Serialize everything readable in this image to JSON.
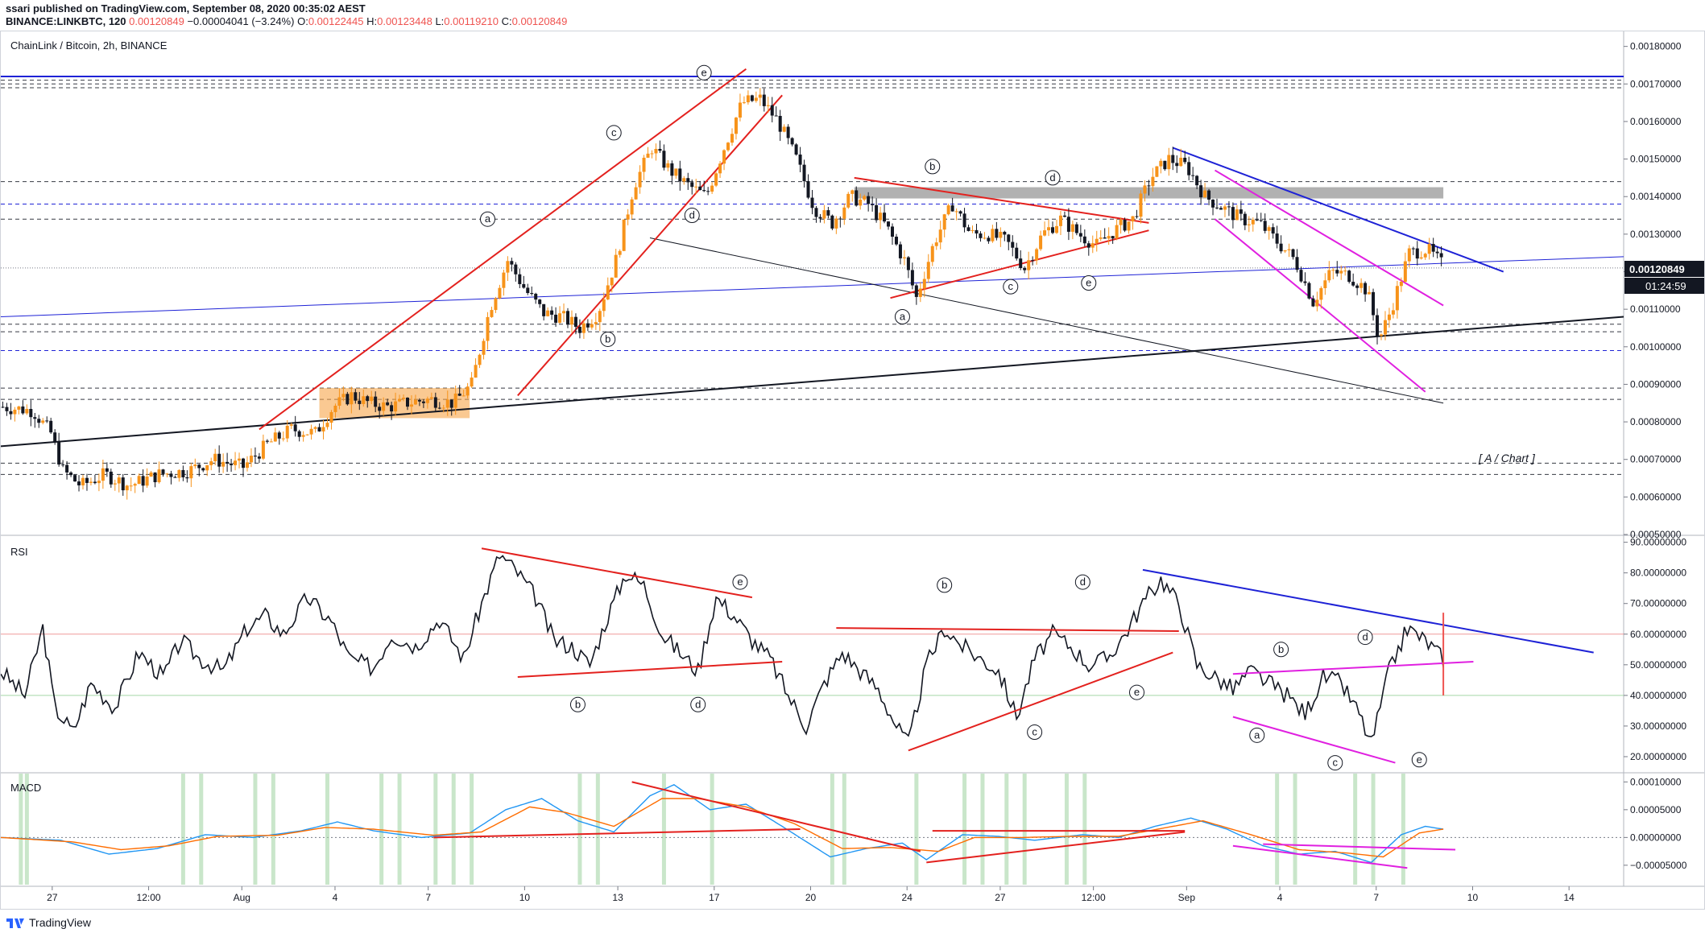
{
  "header": {
    "publisher_line": "ssari published on TradingView.com, September 08, 2020 00:35:02 AEST",
    "symbol": "BINANCE:LINKBTC, 120",
    "last": "0.00120849",
    "change": "−0.00004041 (−3.24%)",
    "open_label": "O:",
    "open": "0.00122445",
    "high_label": "H:",
    "high": "0.00123448",
    "low_label": "L:",
    "low": "0.00119210",
    "close_label": "C:",
    "close": "0.00120849"
  },
  "panes": {
    "main_title": "ChainLink / Bitcoin, 2h, BINANCE",
    "rsi_title": "RSI",
    "macd_title": "MACD",
    "annotation": "[ A / Chart ]"
  },
  "price_badge": {
    "price": "0.00120849",
    "countdown": "01:24:59"
  },
  "footer": {
    "brand": "TradingView"
  },
  "colors": {
    "up": "#f7931a",
    "down": "#131722",
    "red_line": "#e3211e",
    "blue_line": "#1e22d6",
    "magenta_line": "#e020e0"
  },
  "chart_data": [
    {
      "type": "candlestick",
      "title": "ChainLink / Bitcoin, 2h, BINANCE",
      "y_ticks": [
        "0.00180000",
        "0.00170000",
        "0.00160000",
        "0.00150000",
        "0.00140000",
        "0.00130000",
        "0.00120000",
        "0.00110000",
        "0.00100000",
        "0.00090000",
        "0.00080000",
        "0.00070000",
        "0.00060000",
        "0.00050000"
      ],
      "ylim": [
        0.0005,
        0.00184
      ],
      "x_ticks": [
        "27",
        "12:00",
        "Aug",
        "4",
        "7",
        "10",
        "13",
        "17",
        "20",
        "24",
        "27",
        "12:00",
        "Sep",
        "4",
        "7",
        "10",
        "14"
      ],
      "close_path": [
        {
          "x": 0,
          "y": 0.00084
        },
        {
          "x": 5,
          "y": 0.00083
        },
        {
          "x": 8,
          "y": 0.00077
        },
        {
          "x": 10,
          "y": 0.00067
        },
        {
          "x": 13,
          "y": 0.00063
        },
        {
          "x": 17,
          "y": 0.00066
        },
        {
          "x": 21,
          "y": 0.00063
        },
        {
          "x": 26,
          "y": 0.00066
        },
        {
          "x": 31,
          "y": 0.00067
        },
        {
          "x": 35,
          "y": 0.0007
        },
        {
          "x": 40,
          "y": 0.00068
        },
        {
          "x": 44,
          "y": 0.00074
        },
        {
          "x": 48,
          "y": 0.00078
        },
        {
          "x": 52,
          "y": 0.00077
        },
        {
          "x": 55,
          "y": 0.00084
        },
        {
          "x": 58,
          "y": 0.00087
        },
        {
          "x": 61,
          "y": 0.00085
        },
        {
          "x": 64,
          "y": 0.00084
        },
        {
          "x": 67,
          "y": 0.00085
        },
        {
          "x": 71,
          "y": 0.00086
        },
        {
          "x": 75,
          "y": 0.00085
        },
        {
          "x": 78,
          "y": 0.0009
        },
        {
          "x": 81,
          "y": 0.0011
        },
        {
          "x": 84,
          "y": 0.00123
        },
        {
          "x": 87,
          "y": 0.00115
        },
        {
          "x": 90,
          "y": 0.00109
        },
        {
          "x": 93,
          "y": 0.00108
        },
        {
          "x": 96,
          "y": 0.00105
        },
        {
          "x": 99,
          "y": 0.00109
        },
        {
          "x": 102,
          "y": 0.00123
        },
        {
          "x": 105,
          "y": 0.00143
        },
        {
          "x": 108,
          "y": 0.00153
        },
        {
          "x": 111,
          "y": 0.00147
        },
        {
          "x": 114,
          "y": 0.00143
        },
        {
          "x": 117,
          "y": 0.0014
        },
        {
          "x": 120,
          "y": 0.00153
        },
        {
          "x": 123,
          "y": 0.00165
        },
        {
          "x": 126,
          "y": 0.00166
        },
        {
          "x": 129,
          "y": 0.0016
        },
        {
          "x": 132,
          "y": 0.0015
        },
        {
          "x": 135,
          "y": 0.00137
        },
        {
          "x": 138,
          "y": 0.00133
        },
        {
          "x": 141,
          "y": 0.0014
        },
        {
          "x": 144,
          "y": 0.00138
        },
        {
          "x": 147,
          "y": 0.00132
        },
        {
          "x": 150,
          "y": 0.00123
        },
        {
          "x": 152,
          "y": 0.00113
        },
        {
          "x": 155,
          "y": 0.00128
        },
        {
          "x": 158,
          "y": 0.00138
        },
        {
          "x": 161,
          "y": 0.0013
        },
        {
          "x": 164,
          "y": 0.0013
        },
        {
          "x": 167,
          "y": 0.00128
        },
        {
          "x": 170,
          "y": 0.00121
        },
        {
          "x": 173,
          "y": 0.0013
        },
        {
          "x": 176,
          "y": 0.00134
        },
        {
          "x": 179,
          "y": 0.0013
        },
        {
          "x": 182,
          "y": 0.00127
        },
        {
          "x": 185,
          "y": 0.00131
        },
        {
          "x": 188,
          "y": 0.00134
        },
        {
          "x": 191,
          "y": 0.00145
        },
        {
          "x": 194,
          "y": 0.0015
        },
        {
          "x": 197,
          "y": 0.00148
        },
        {
          "x": 200,
          "y": 0.0014
        },
        {
          "x": 203,
          "y": 0.00137
        },
        {
          "x": 206,
          "y": 0.00134
        },
        {
          "x": 209,
          "y": 0.00133
        },
        {
          "x": 212,
          "y": 0.00128
        },
        {
          "x": 215,
          "y": 0.00123
        },
        {
          "x": 218,
          "y": 0.00112
        },
        {
          "x": 221,
          "y": 0.0012
        },
        {
          "x": 224,
          "y": 0.00119
        },
        {
          "x": 227,
          "y": 0.00115
        },
        {
          "x": 229,
          "y": 0.00102
        },
        {
          "x": 231,
          "y": 0.0011
        },
        {
          "x": 234,
          "y": 0.00125
        },
        {
          "x": 237,
          "y": 0.00126
        },
        {
          "x": 240,
          "y": 0.00121
        }
      ]
    },
    {
      "type": "line",
      "title": "RSI",
      "y_ticks": [
        "90.00000000",
        "80.00000000",
        "70.00000000",
        "60.00000000",
        "50.00000000",
        "40.00000000",
        "30.00000000",
        "20.00000000"
      ],
      "ylim": [
        15,
        92
      ],
      "bands": [
        60,
        40
      ],
      "series": [
        {
          "values": [
            {
              "x": 0,
              "y": 48
            },
            {
              "x": 4,
              "y": 40
            },
            {
              "x": 7,
              "y": 62
            },
            {
              "x": 9,
              "y": 36
            },
            {
              "x": 12,
              "y": 28
            },
            {
              "x": 15,
              "y": 44
            },
            {
              "x": 19,
              "y": 36
            },
            {
              "x": 23,
              "y": 54
            },
            {
              "x": 27,
              "y": 46
            },
            {
              "x": 30,
              "y": 58
            },
            {
              "x": 33,
              "y": 52
            },
            {
              "x": 37,
              "y": 48
            },
            {
              "x": 41,
              "y": 62
            },
            {
              "x": 44,
              "y": 66
            },
            {
              "x": 47,
              "y": 60
            },
            {
              "x": 51,
              "y": 72
            },
            {
              "x": 55,
              "y": 64
            },
            {
              "x": 58,
              "y": 52
            },
            {
              "x": 62,
              "y": 49
            },
            {
              "x": 65,
              "y": 60
            },
            {
              "x": 69,
              "y": 56
            },
            {
              "x": 73,
              "y": 65
            },
            {
              "x": 77,
              "y": 52
            },
            {
              "x": 80,
              "y": 70
            },
            {
              "x": 83,
              "y": 86
            },
            {
              "x": 86,
              "y": 80
            },
            {
              "x": 89,
              "y": 72
            },
            {
              "x": 92,
              "y": 58
            },
            {
              "x": 95,
              "y": 56
            },
            {
              "x": 98,
              "y": 50
            },
            {
              "x": 101,
              "y": 66
            },
            {
              "x": 104,
              "y": 80
            },
            {
              "x": 107,
              "y": 76
            },
            {
              "x": 110,
              "y": 60
            },
            {
              "x": 113,
              "y": 54
            },
            {
              "x": 116,
              "y": 48
            },
            {
              "x": 119,
              "y": 72
            },
            {
              "x": 122,
              "y": 66
            },
            {
              "x": 125,
              "y": 58
            },
            {
              "x": 128,
              "y": 52
            },
            {
              "x": 131,
              "y": 40
            },
            {
              "x": 134,
              "y": 30
            },
            {
              "x": 137,
              "y": 44
            },
            {
              "x": 140,
              "y": 54
            },
            {
              "x": 143,
              "y": 48
            },
            {
              "x": 146,
              "y": 42
            },
            {
              "x": 149,
              "y": 30
            },
            {
              "x": 151,
              "y": 24
            },
            {
              "x": 154,
              "y": 50
            },
            {
              "x": 157,
              "y": 62
            },
            {
              "x": 160,
              "y": 56
            },
            {
              "x": 163,
              "y": 52
            },
            {
              "x": 166,
              "y": 48
            },
            {
              "x": 169,
              "y": 33
            },
            {
              "x": 172,
              "y": 52
            },
            {
              "x": 175,
              "y": 60
            },
            {
              "x": 178,
              "y": 56
            },
            {
              "x": 181,
              "y": 50
            },
            {
              "x": 184,
              "y": 52
            },
            {
              "x": 187,
              "y": 60
            },
            {
              "x": 190,
              "y": 70
            },
            {
              "x": 193,
              "y": 78
            },
            {
              "x": 196,
              "y": 70
            },
            {
              "x": 199,
              "y": 50
            },
            {
              "x": 202,
              "y": 46
            },
            {
              "x": 205,
              "y": 42
            },
            {
              "x": 208,
              "y": 48
            },
            {
              "x": 211,
              "y": 44
            },
            {
              "x": 214,
              "y": 40
            },
            {
              "x": 217,
              "y": 34
            },
            {
              "x": 220,
              "y": 46
            },
            {
              "x": 223,
              "y": 44
            },
            {
              "x": 226,
              "y": 34
            },
            {
              "x": 228,
              "y": 24
            },
            {
              "x": 231,
              "y": 48
            },
            {
              "x": 234,
              "y": 62
            },
            {
              "x": 237,
              "y": 58
            },
            {
              "x": 240,
              "y": 52
            }
          ]
        }
      ]
    },
    {
      "type": "line",
      "title": "MACD",
      "y_ticks": [
        "0.00010000",
        "0.00005000",
        "0.00000000",
        "−0.00005000"
      ],
      "ylim": [
        -8.5e-05,
        0.000115
      ],
      "series": [
        {
          "values": [
            {
              "x": 0,
              "y": 0.0
            },
            {
              "x": 10,
              "y": -5e-06
            },
            {
              "x": 18,
              "y": -3e-05
            },
            {
              "x": 26,
              "y": -2e-05
            },
            {
              "x": 34,
              "y": 5e-06
            },
            {
              "x": 42,
              "y": 0.0
            },
            {
              "x": 50,
              "y": 1.2e-05
            },
            {
              "x": 56,
              "y": 2.8e-05
            },
            {
              "x": 62,
              "y": 1.2e-05
            },
            {
              "x": 70,
              "y": 0.0
            },
            {
              "x": 78,
              "y": 8e-06
            },
            {
              "x": 84,
              "y": 5e-05
            },
            {
              "x": 90,
              "y": 7e-05
            },
            {
              "x": 96,
              "y": 3e-05
            },
            {
              "x": 102,
              "y": 1e-05
            },
            {
              "x": 108,
              "y": 7.5e-05
            },
            {
              "x": 112,
              "y": 9.5e-05
            },
            {
              "x": 118,
              "y": 5e-05
            },
            {
              "x": 124,
              "y": 6e-05
            },
            {
              "x": 130,
              "y": 2e-05
            },
            {
              "x": 138,
              "y": -3.5e-05
            },
            {
              "x": 144,
              "y": -2e-05
            },
            {
              "x": 150,
              "y": -1e-05
            },
            {
              "x": 154,
              "y": -4e-05
            },
            {
              "x": 160,
              "y": 5e-06
            },
            {
              "x": 166,
              "y": 2e-06
            },
            {
              "x": 172,
              "y": -5e-06
            },
            {
              "x": 180,
              "y": 5e-06
            },
            {
              "x": 186,
              "y": 0.0
            },
            {
              "x": 192,
              "y": 2e-05
            },
            {
              "x": 198,
              "y": 3.5e-05
            },
            {
              "x": 204,
              "y": 1.5e-05
            },
            {
              "x": 210,
              "y": -1.5e-05
            },
            {
              "x": 216,
              "y": -3e-05
            },
            {
              "x": 222,
              "y": -2.5e-05
            },
            {
              "x": 228,
              "y": -4.5e-05
            },
            {
              "x": 233,
              "y": 5e-06
            },
            {
              "x": 237,
              "y": 2e-05
            },
            {
              "x": 240,
              "y": 1.5e-05
            }
          ]
        },
        {
          "values": [
            {
              "x": 0,
              "y": 0.0
            },
            {
              "x": 12,
              "y": -8e-06
            },
            {
              "x": 20,
              "y": -2.2e-05
            },
            {
              "x": 28,
              "y": -1.5e-05
            },
            {
              "x": 36,
              "y": 2e-06
            },
            {
              "x": 46,
              "y": 4e-06
            },
            {
              "x": 54,
              "y": 1.8e-05
            },
            {
              "x": 62,
              "y": 1.5e-05
            },
            {
              "x": 72,
              "y": 4e-06
            },
            {
              "x": 80,
              "y": 1e-05
            },
            {
              "x": 88,
              "y": 5.5e-05
            },
            {
              "x": 94,
              "y": 4.5e-05
            },
            {
              "x": 102,
              "y": 2e-05
            },
            {
              "x": 110,
              "y": 7e-05
            },
            {
              "x": 116,
              "y": 7e-05
            },
            {
              "x": 124,
              "y": 5.5e-05
            },
            {
              "x": 132,
              "y": 2.5e-05
            },
            {
              "x": 140,
              "y": -2e-05
            },
            {
              "x": 148,
              "y": -1.8e-05
            },
            {
              "x": 156,
              "y": -2.5e-05
            },
            {
              "x": 162,
              "y": 0.0
            },
            {
              "x": 170,
              "y": 0.0
            },
            {
              "x": 178,
              "y": 2e-06
            },
            {
              "x": 186,
              "y": 2e-06
            },
            {
              "x": 194,
              "y": 1.8e-05
            },
            {
              "x": 200,
              "y": 3e-05
            },
            {
              "x": 208,
              "y": 5e-06
            },
            {
              "x": 216,
              "y": -2.2e-05
            },
            {
              "x": 224,
              "y": -2.8e-05
            },
            {
              "x": 230,
              "y": -3.5e-05
            },
            {
              "x": 236,
              "y": 8e-06
            },
            {
              "x": 240,
              "y": 1.5e-05
            }
          ]
        }
      ]
    }
  ]
}
